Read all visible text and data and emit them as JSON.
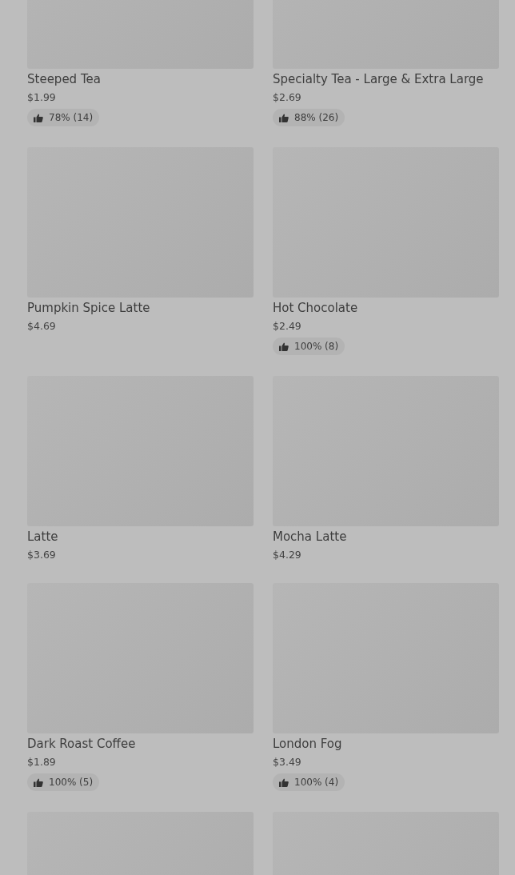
{
  "items": [
    {
      "kind": "placeholder",
      "name": "Steeped Tea",
      "price": "$1.99",
      "rating": "78% (14)"
    },
    {
      "kind": "placeholder",
      "name": "Specialty Tea - Large & Extra Large",
      "price": "$2.69",
      "rating": "88% (26)"
    },
    {
      "kind": "placeholder",
      "name": "Pumpkin Spice Latte",
      "price": "$4.69"
    },
    {
      "kind": "placeholder",
      "name": "Hot Chocolate",
      "price": "$2.49",
      "rating": "100% (8)"
    },
    {
      "kind": "placeholder",
      "name": "Latte",
      "price": "$3.69"
    },
    {
      "kind": "placeholder",
      "name": "Mocha Latte",
      "price": "$4.29"
    },
    {
      "kind": "placeholder",
      "name": "Dark Roast Coffee",
      "price": "$1.89",
      "rating": "100% (5)"
    },
    {
      "kind": "placeholder",
      "name": "London Fog",
      "price": "$3.49",
      "rating": "100% (4)"
    },
    {
      "kind": "placeholder"
    },
    {
      "kind": "placeholder"
    }
  ]
}
